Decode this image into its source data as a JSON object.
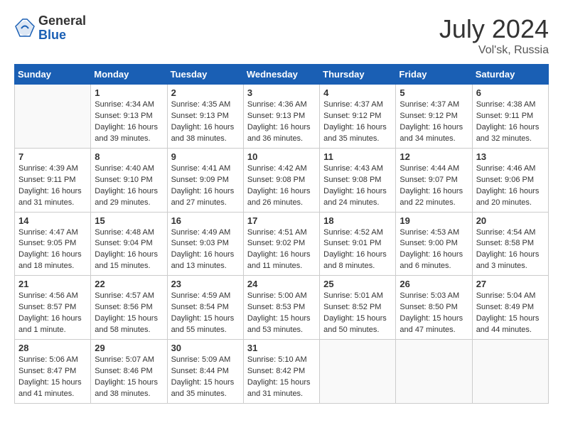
{
  "header": {
    "logo_general": "General",
    "logo_blue": "Blue",
    "month_year": "July 2024",
    "location": "Vol'sk, Russia"
  },
  "calendar": {
    "days_of_week": [
      "Sunday",
      "Monday",
      "Tuesday",
      "Wednesday",
      "Thursday",
      "Friday",
      "Saturday"
    ],
    "weeks": [
      [
        {
          "day": "",
          "empty": true
        },
        {
          "day": "1",
          "sunrise": "Sunrise: 4:34 AM",
          "sunset": "Sunset: 9:13 PM",
          "daylight": "Daylight: 16 hours and 39 minutes."
        },
        {
          "day": "2",
          "sunrise": "Sunrise: 4:35 AM",
          "sunset": "Sunset: 9:13 PM",
          "daylight": "Daylight: 16 hours and 38 minutes."
        },
        {
          "day": "3",
          "sunrise": "Sunrise: 4:36 AM",
          "sunset": "Sunset: 9:13 PM",
          "daylight": "Daylight: 16 hours and 36 minutes."
        },
        {
          "day": "4",
          "sunrise": "Sunrise: 4:37 AM",
          "sunset": "Sunset: 9:12 PM",
          "daylight": "Daylight: 16 hours and 35 minutes."
        },
        {
          "day": "5",
          "sunrise": "Sunrise: 4:37 AM",
          "sunset": "Sunset: 9:12 PM",
          "daylight": "Daylight: 16 hours and 34 minutes."
        },
        {
          "day": "6",
          "sunrise": "Sunrise: 4:38 AM",
          "sunset": "Sunset: 9:11 PM",
          "daylight": "Daylight: 16 hours and 32 minutes."
        }
      ],
      [
        {
          "day": "7",
          "sunrise": "Sunrise: 4:39 AM",
          "sunset": "Sunset: 9:11 PM",
          "daylight": "Daylight: 16 hours and 31 minutes."
        },
        {
          "day": "8",
          "sunrise": "Sunrise: 4:40 AM",
          "sunset": "Sunset: 9:10 PM",
          "daylight": "Daylight: 16 hours and 29 minutes."
        },
        {
          "day": "9",
          "sunrise": "Sunrise: 4:41 AM",
          "sunset": "Sunset: 9:09 PM",
          "daylight": "Daylight: 16 hours and 27 minutes."
        },
        {
          "day": "10",
          "sunrise": "Sunrise: 4:42 AM",
          "sunset": "Sunset: 9:08 PM",
          "daylight": "Daylight: 16 hours and 26 minutes."
        },
        {
          "day": "11",
          "sunrise": "Sunrise: 4:43 AM",
          "sunset": "Sunset: 9:08 PM",
          "daylight": "Daylight: 16 hours and 24 minutes."
        },
        {
          "day": "12",
          "sunrise": "Sunrise: 4:44 AM",
          "sunset": "Sunset: 9:07 PM",
          "daylight": "Daylight: 16 hours and 22 minutes."
        },
        {
          "day": "13",
          "sunrise": "Sunrise: 4:46 AM",
          "sunset": "Sunset: 9:06 PM",
          "daylight": "Daylight: 16 hours and 20 minutes."
        }
      ],
      [
        {
          "day": "14",
          "sunrise": "Sunrise: 4:47 AM",
          "sunset": "Sunset: 9:05 PM",
          "daylight": "Daylight: 16 hours and 18 minutes."
        },
        {
          "day": "15",
          "sunrise": "Sunrise: 4:48 AM",
          "sunset": "Sunset: 9:04 PM",
          "daylight": "Daylight: 16 hours and 15 minutes."
        },
        {
          "day": "16",
          "sunrise": "Sunrise: 4:49 AM",
          "sunset": "Sunset: 9:03 PM",
          "daylight": "Daylight: 16 hours and 13 minutes."
        },
        {
          "day": "17",
          "sunrise": "Sunrise: 4:51 AM",
          "sunset": "Sunset: 9:02 PM",
          "daylight": "Daylight: 16 hours and 11 minutes."
        },
        {
          "day": "18",
          "sunrise": "Sunrise: 4:52 AM",
          "sunset": "Sunset: 9:01 PM",
          "daylight": "Daylight: 16 hours and 8 minutes."
        },
        {
          "day": "19",
          "sunrise": "Sunrise: 4:53 AM",
          "sunset": "Sunset: 9:00 PM",
          "daylight": "Daylight: 16 hours and 6 minutes."
        },
        {
          "day": "20",
          "sunrise": "Sunrise: 4:54 AM",
          "sunset": "Sunset: 8:58 PM",
          "daylight": "Daylight: 16 hours and 3 minutes."
        }
      ],
      [
        {
          "day": "21",
          "sunrise": "Sunrise: 4:56 AM",
          "sunset": "Sunset: 8:57 PM",
          "daylight": "Daylight: 16 hours and 1 minute."
        },
        {
          "day": "22",
          "sunrise": "Sunrise: 4:57 AM",
          "sunset": "Sunset: 8:56 PM",
          "daylight": "Daylight: 15 hours and 58 minutes."
        },
        {
          "day": "23",
          "sunrise": "Sunrise: 4:59 AM",
          "sunset": "Sunset: 8:54 PM",
          "daylight": "Daylight: 15 hours and 55 minutes."
        },
        {
          "day": "24",
          "sunrise": "Sunrise: 5:00 AM",
          "sunset": "Sunset: 8:53 PM",
          "daylight": "Daylight: 15 hours and 53 minutes."
        },
        {
          "day": "25",
          "sunrise": "Sunrise: 5:01 AM",
          "sunset": "Sunset: 8:52 PM",
          "daylight": "Daylight: 15 hours and 50 minutes."
        },
        {
          "day": "26",
          "sunrise": "Sunrise: 5:03 AM",
          "sunset": "Sunset: 8:50 PM",
          "daylight": "Daylight: 15 hours and 47 minutes."
        },
        {
          "day": "27",
          "sunrise": "Sunrise: 5:04 AM",
          "sunset": "Sunset: 8:49 PM",
          "daylight": "Daylight: 15 hours and 44 minutes."
        }
      ],
      [
        {
          "day": "28",
          "sunrise": "Sunrise: 5:06 AM",
          "sunset": "Sunset: 8:47 PM",
          "daylight": "Daylight: 15 hours and 41 minutes."
        },
        {
          "day": "29",
          "sunrise": "Sunrise: 5:07 AM",
          "sunset": "Sunset: 8:46 PM",
          "daylight": "Daylight: 15 hours and 38 minutes."
        },
        {
          "day": "30",
          "sunrise": "Sunrise: 5:09 AM",
          "sunset": "Sunset: 8:44 PM",
          "daylight": "Daylight: 15 hours and 35 minutes."
        },
        {
          "day": "31",
          "sunrise": "Sunrise: 5:10 AM",
          "sunset": "Sunset: 8:42 PM",
          "daylight": "Daylight: 15 hours and 31 minutes."
        },
        {
          "day": "",
          "empty": true
        },
        {
          "day": "",
          "empty": true
        },
        {
          "day": "",
          "empty": true
        }
      ]
    ]
  }
}
